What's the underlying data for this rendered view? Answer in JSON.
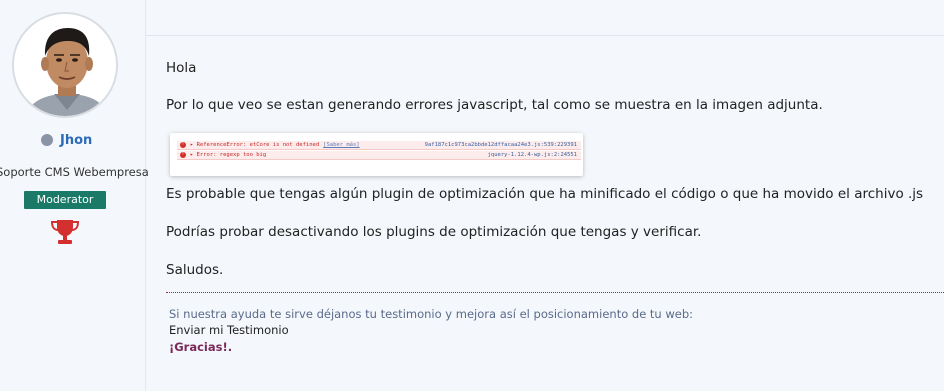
{
  "author": {
    "name": "Jhon",
    "title": "Soporte CMS Webempresa",
    "role": "Moderator",
    "status_color": "#8a94a6",
    "badge_color": "#1a7a67",
    "trophy_icon": "trophy-icon",
    "trophy_color": "#d32f2f"
  },
  "post": {
    "greeting": "Hola",
    "p1": "Por lo que veo se estan generando errores javascript, tal como se muestra en la imagen adjunta.",
    "p2": "Es probable que tengas algún plugin de optimización que ha minificado el código o que ha movido el archivo .js",
    "p3": "Podrías probar desactivando los plugins de optimización que tengas y verificar.",
    "p4": "Saludos."
  },
  "screenshot": {
    "errors": [
      {
        "text": "▸ ReferenceError: etCore is not defined",
        "link": "[Saber más]",
        "source": "9af187c1c973ca2bbde12dffacaa24e3.js:539:229391"
      },
      {
        "text": "▸ Error: regexp too big",
        "link": "",
        "source": "jquery-1.12.4-wp.js:2:24551"
      }
    ]
  },
  "signature": {
    "line1": "Si nuestra ayuda te sirve déjanos tu testimonio y mejora así el posicionamiento de tu web:",
    "line2": "Enviar mi Testimonio",
    "line3": "¡Gracias!."
  }
}
